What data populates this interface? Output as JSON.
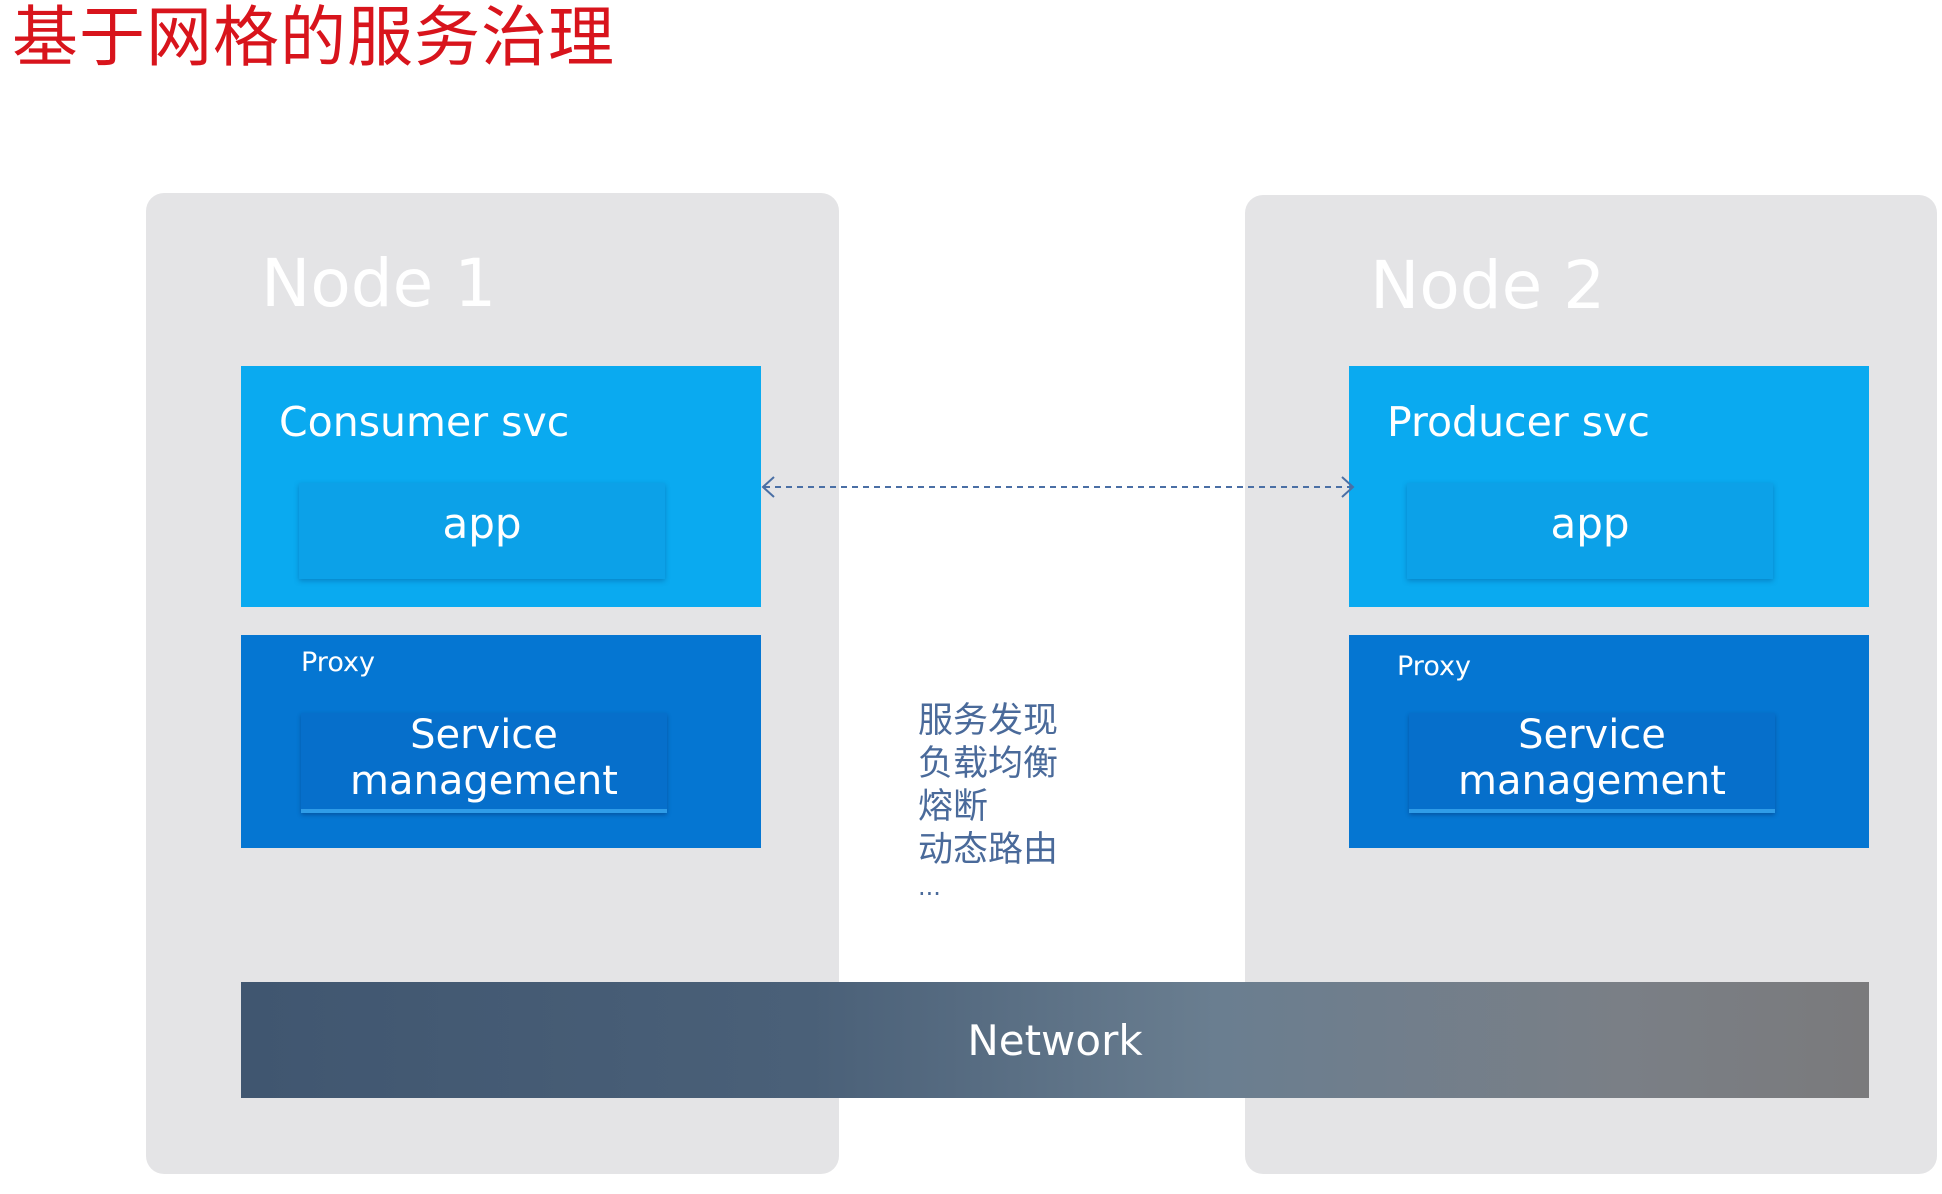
{
  "title": "基于网格的服务治理",
  "nodes": [
    {
      "title": "Node 1",
      "svc_title": "Consumer svc",
      "app_label": "app",
      "proxy_label": "Proxy",
      "management_lines": [
        "Service",
        "management"
      ]
    },
    {
      "title": "Node 2",
      "svc_title": "Producer svc",
      "app_label": "app",
      "proxy_label": "Proxy",
      "management_lines": [
        "Service",
        "management"
      ]
    }
  ],
  "features": [
    "服务发现",
    "负载均衡",
    "熔断",
    "动态路由",
    "..."
  ],
  "network_label": "Network",
  "colors": {
    "title": "#d8141c",
    "node_bg": "#e4e4e6",
    "svc_bg": "#0aaaf0",
    "proxy_bg": "#0576d2",
    "feature_text": "#4a6a9a",
    "connector": "#4a6fa5"
  }
}
